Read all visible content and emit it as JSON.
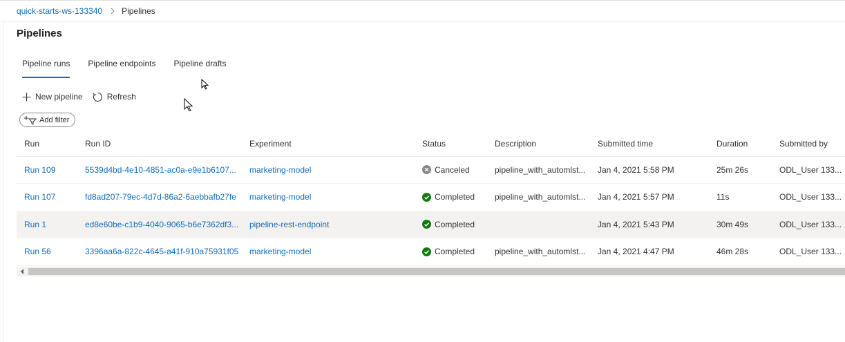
{
  "breadcrumb": {
    "workspace": "quick-starts-ws-133340",
    "current": "Pipelines"
  },
  "page": {
    "title": "Pipelines"
  },
  "tabs": [
    {
      "label": "Pipeline runs",
      "active": true
    },
    {
      "label": "Pipeline endpoints",
      "active": false
    },
    {
      "label": "Pipeline drafts",
      "active": false
    }
  ],
  "toolbar": {
    "new_pipeline": "New pipeline",
    "refresh": "Refresh",
    "add_filter": "Add filter"
  },
  "table": {
    "columns": [
      "Run",
      "Run ID",
      "Experiment",
      "Status",
      "Description",
      "Submitted time",
      "Duration",
      "Submitted by"
    ],
    "rows": [
      {
        "run": "Run 109",
        "run_id": "5539d4bd-4e10-4851-ac0a-e9e1b6107...",
        "experiment": "marketing-model",
        "status": "Canceled",
        "description": "pipeline_with_automlst...",
        "submitted_time": "Jan 4, 2021 5:58 PM",
        "duration": "25m 26s",
        "submitted_by": "ODL_User 133..."
      },
      {
        "run": "Run 107",
        "run_id": "fd8ad207-79ec-4d7d-86a2-6aebbafb27fe",
        "experiment": "marketing-model",
        "status": "Completed",
        "description": "pipeline_with_automlst...",
        "submitted_time": "Jan 4, 2021 5:57 PM",
        "duration": "11s",
        "submitted_by": "ODL_User 133..."
      },
      {
        "run": "Run 1",
        "run_id": "ed8e60be-c1b9-4040-9065-b6e7362df3...",
        "experiment": "pipeline-rest-endpoint",
        "status": "Completed",
        "description": "",
        "submitted_time": "Jan 4, 2021 5:43 PM",
        "duration": "30m 49s",
        "submitted_by": "ODL_User 133..."
      },
      {
        "run": "Run 56",
        "run_id": "3396aa6a-822c-4645-a41f-910a75931f05",
        "experiment": "marketing-model",
        "status": "Completed",
        "description": "pipeline_with_automlst...",
        "submitted_time": "Jan 4, 2021 4:47 PM",
        "duration": "46m 28s",
        "submitted_by": "ODL_User 133..."
      }
    ]
  },
  "colors": {
    "link": "#0f6cbd",
    "completed": "#107c10",
    "canceled": "#8a8886",
    "selected_row": "#f3f2f1"
  },
  "icons": [
    "chevron-right-icon",
    "plus-icon",
    "refresh-icon",
    "add-filter-icon",
    "check-circle-icon",
    "cancel-circle-icon",
    "mouse-cursor-icon"
  ]
}
